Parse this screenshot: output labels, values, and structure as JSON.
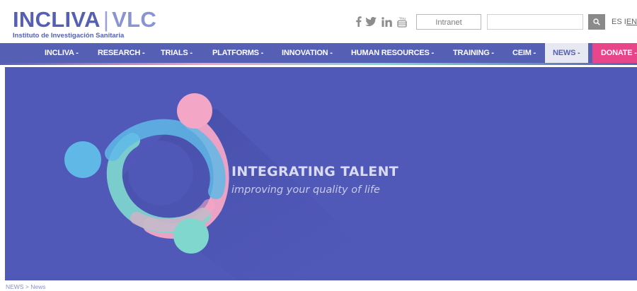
{
  "header": {
    "logo_main": "INCLIVA",
    "logo_sep": "|",
    "logo_vlc": "VLC",
    "logo_subtitle": "Instituto de Investigación Sanitaria",
    "social_icons": [
      "facebook-icon",
      "twitter-icon",
      "linkedin-icon",
      "youtube-icon"
    ],
    "intranet_label": "Intranet",
    "search_value": "",
    "lang_es": "ES",
    "lang_sep": "I",
    "lang_en": "EN"
  },
  "nav": {
    "items": [
      {
        "label": "INCLIVA -"
      },
      {
        "label": "RESEARCH -"
      },
      {
        "label": "TRIALS -"
      },
      {
        "label": "PLATFORMS -"
      },
      {
        "label": "INNOVATION -"
      },
      {
        "label": "HUMAN RESOURCES -"
      },
      {
        "label": "TRAINING -"
      },
      {
        "label": "CEIM -"
      },
      {
        "label": "NEWS -"
      },
      {
        "label": "DONATE -"
      }
    ]
  },
  "hero": {
    "title": "INTEGRATING TALENT",
    "subtitle": "improving your quality of life",
    "colors": {
      "background": "#5058b8",
      "pink": "#f3a6c6",
      "blue": "#5fb8e6",
      "teal": "#7fd7ce"
    }
  },
  "breadcrumb": {
    "root": "NEWS",
    "separator": ">",
    "current": "News"
  }
}
